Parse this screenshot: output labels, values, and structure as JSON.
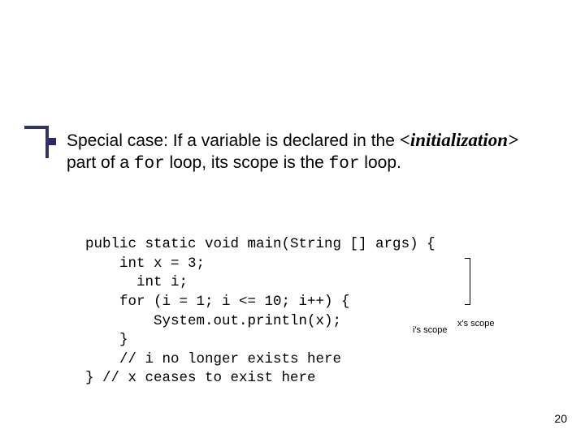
{
  "decoration": {
    "hr": true,
    "vr": true,
    "bullet": true
  },
  "paragraph": {
    "pre": "Special case: If a variable is declared in the ",
    "ital": "<initialization>",
    "mid1": " part of a ",
    "mono1": "for",
    "mid2": " loop, its scope is the ",
    "mono2": "for",
    "post": " loop."
  },
  "code": "public static void main(String [] args) {\n    int x = 3;\n      int i;\n    for (i = 1; i <= 10; i++) {\n        System.out.println(x);\n    }\n    // i no longer exists here\n} // x ceases to exist here",
  "scope_labels": {
    "i": "i's scope",
    "x": "x's scope"
  },
  "page_number": "20"
}
